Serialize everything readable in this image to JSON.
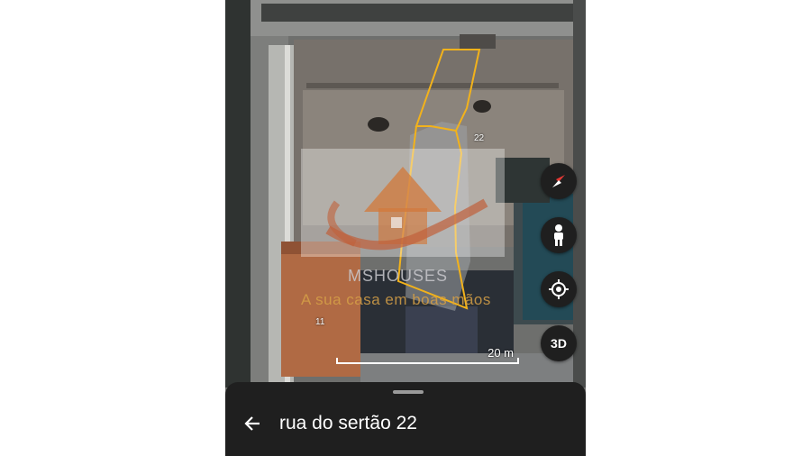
{
  "map": {
    "lot_numbers": [
      "22",
      "11"
    ],
    "scale_label": "20 m",
    "boundary_color": "#f2b21b"
  },
  "watermark": {
    "brand": "MSHOUSES",
    "slogan": "A sua casa em boas mãos"
  },
  "controls": {
    "compass_icon": "compass-icon",
    "street_view_icon": "pegman-icon",
    "location_icon": "my-location-icon",
    "view_3d_label": "3D"
  },
  "sheet": {
    "back_icon": "arrow-left-icon",
    "title": "rua do sertão 22"
  }
}
